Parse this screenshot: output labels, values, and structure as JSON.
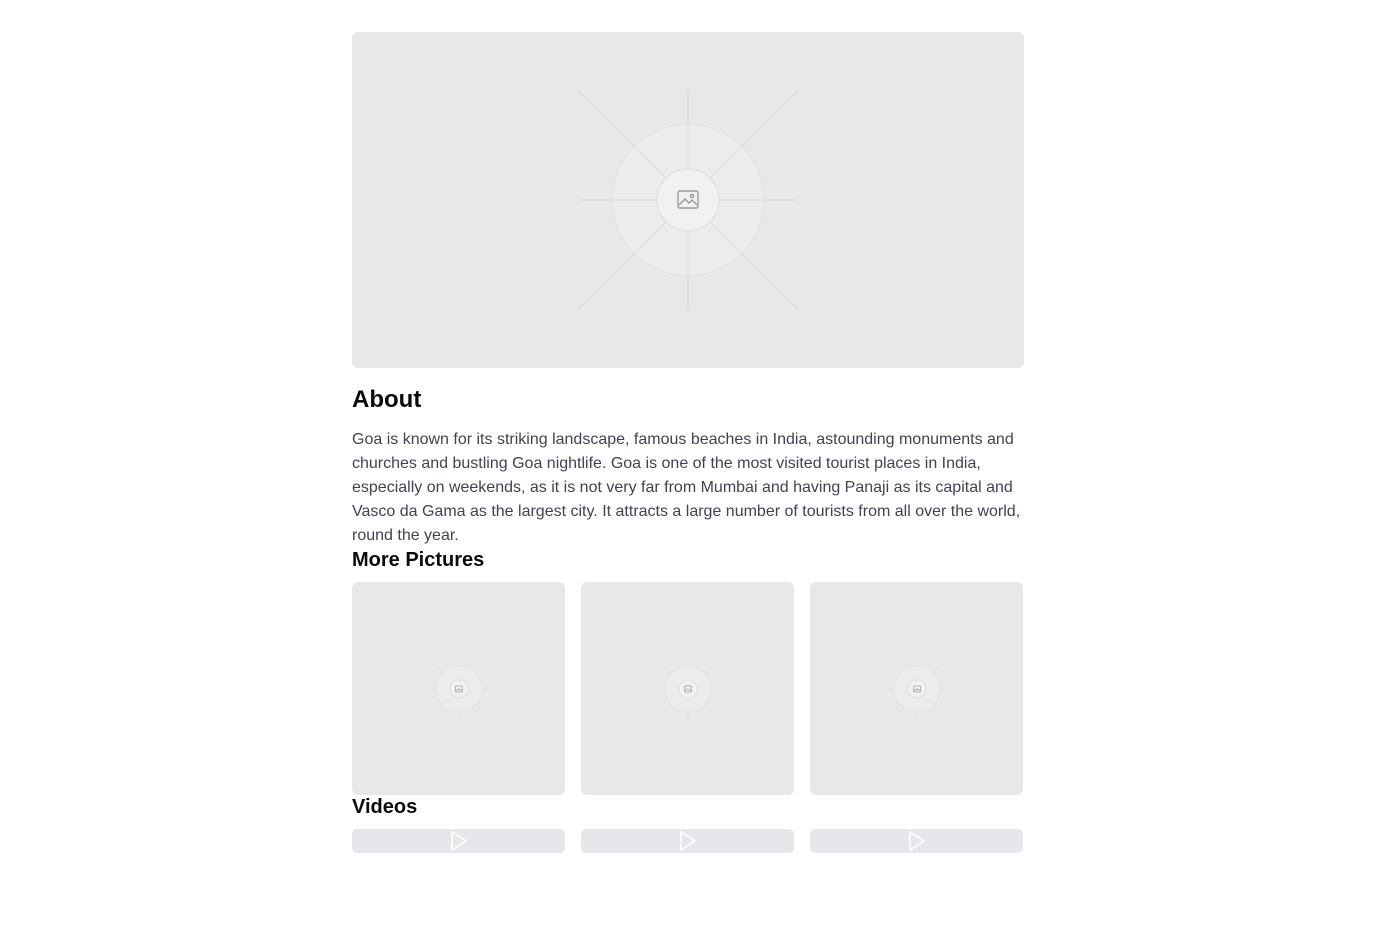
{
  "about": {
    "title": "About",
    "body": "Goa is known for its striking landscape, famous beaches in India, astounding monuments and churches and bustling Goa nightlife. Goa is one of the most visited tourist places in India, especially on weekends, as it is not very far from Mumbai and having Panaji as its capital and Vasco da Gama as the largest city. It attracts a large number of tourists from all over the world, round the year."
  },
  "hero": {
    "icon": "image-placeholder-icon"
  },
  "pictures": {
    "title": "More Pictures",
    "items": [
      {
        "icon": "image-placeholder-icon"
      },
      {
        "icon": "image-placeholder-icon"
      },
      {
        "icon": "image-placeholder-icon"
      }
    ]
  },
  "videos": {
    "title": "Videos",
    "items": [
      {
        "icon": "play-icon"
      },
      {
        "icon": "play-icon"
      },
      {
        "icon": "play-icon"
      }
    ]
  },
  "colors": {
    "placeholder_bg": "#e8e8e8",
    "text_body": "#3f4450",
    "heading": "#0b0b0b"
  }
}
